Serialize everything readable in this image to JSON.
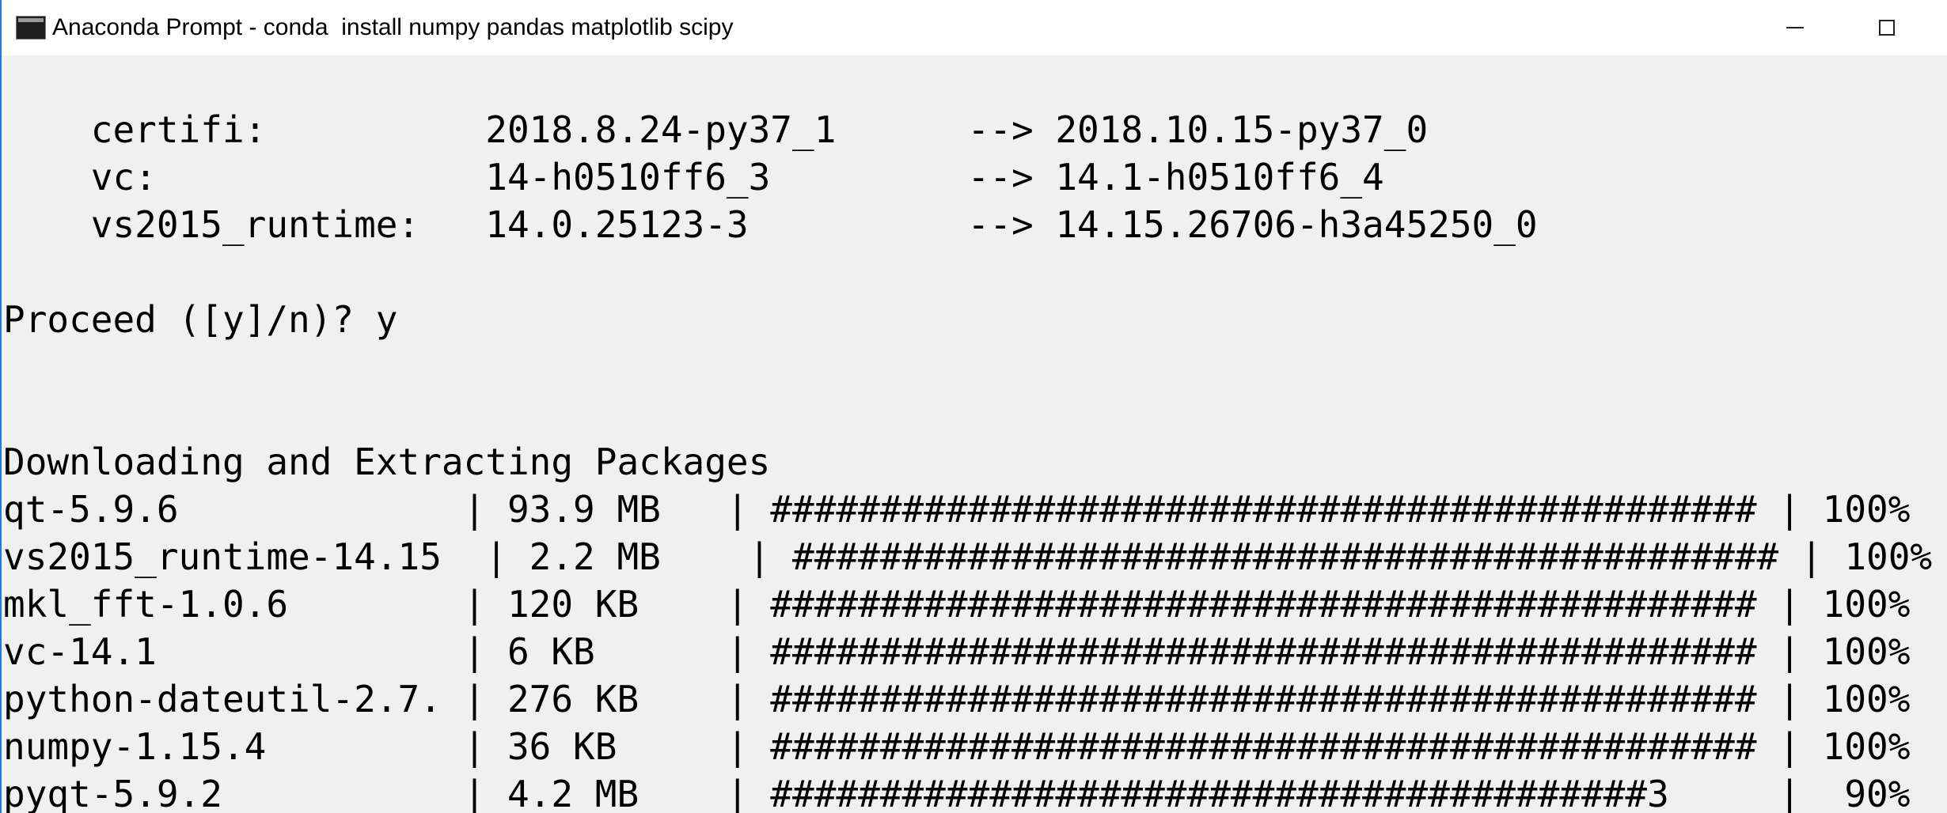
{
  "window": {
    "title": "Anaconda Prompt - conda  install numpy pandas matplotlib scipy",
    "icon": "console-icon",
    "buttons": [
      "minimize-icon",
      "maximize-icon"
    ]
  },
  "console": {
    "lines": {
      "update_certifi": "    certifi:          2018.8.24-py37_1      --> 2018.10.15-py37_0",
      "update_vc": "    vc:               14-h0510ff6_3         --> 14.1-h0510ff6_4",
      "update_vs2015": "    vs2015_runtime:   14.0.25123-3          --> 14.15.26706-h3a45250_0",
      "proceed_prompt": "Proceed ([y]/n)? y",
      "downloading_header": "Downloading and Extracting Packages",
      "pkg_qt": "qt-5.9.6             | 93.9 MB   | ############################################# | 100% ",
      "pkg_vs2015": "vs2015_runtime-14.15  | 2.2 MB    | ############################################# | 100% ",
      "pkg_mkl_fft": "mkl_fft-1.0.6        | 120 KB    | ############################################# | 100% ",
      "pkg_vc": "vc-14.1              | 6 KB      | ############################################# | 100% ",
      "pkg_python_dateutil": "python-dateutil-2.7. | 276 KB    | ############################################# | 100% ",
      "pkg_numpy": "numpy-1.15.4         | 36 KB     | ############################################# | 100% ",
      "pkg_pyqt": "pyqt-5.9.2           | 4.2 MB    | ########################################3     |  90% "
    }
  },
  "colors": {
    "background": "#f0f0f0",
    "text": "#000000",
    "titlebar": "#ffffff",
    "accent_border": "#1f7fd6"
  }
}
